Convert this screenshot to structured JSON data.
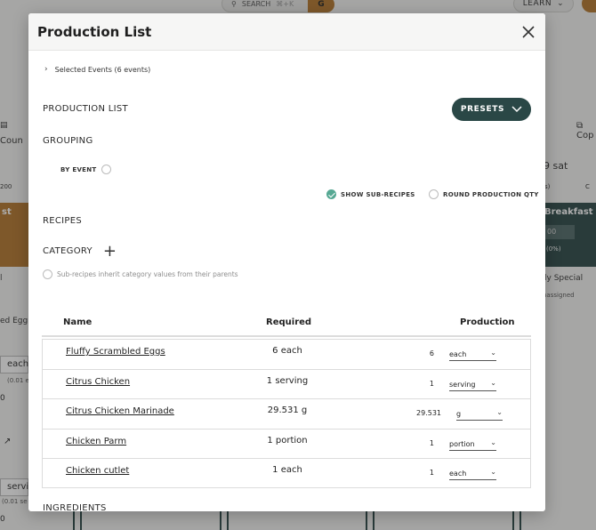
{
  "background": {
    "search_label": "SEARCH",
    "search_shortcut": "⌘+K",
    "avatar_letter": "G",
    "learn_label": "LEARN",
    "left_icon_label": "Coun",
    "left_count": "200",
    "left_event_label": "st",
    "left_text1": "l",
    "left_text2": "ed Egg",
    "left_unit1": "each",
    "left_small1": "(0.01 e",
    "left_zero1": "0",
    "left_unit2": "servi",
    "left_small2": "(0.01 se",
    "left_zero2": "0",
    "right_copy_label": "Cop",
    "right_date": "09 sat",
    "right_s": "s)",
    "right_c": "C",
    "right_event_label": "Breakfast",
    "right_event_value": "00",
    "right_event_pct": "(0%)",
    "right_daily": "aily Special",
    "right_assign": "nassigned"
  },
  "modal": {
    "title": "Production List",
    "selected_events": "Selected Events (6 events)",
    "production_list_label": "PRODUCTION LIST",
    "presets_label": "PRESETS",
    "grouping_label": "GROUPING",
    "by_event_label": "BY EVENT",
    "show_subrecipes_label": "SHOW SUB-RECIPES",
    "round_qty_label": "ROUND PRODUCTION QTY",
    "recipes_label": "RECIPES",
    "category_label": "CATEGORY",
    "inherit_note": "Sub-recipes inherit category values from their parents",
    "table_headers": {
      "name": "Name",
      "required": "Required",
      "production": "Production"
    },
    "rows": [
      {
        "name": "Fluffy Scrambled Eggs",
        "required": "6 each",
        "qty": "6",
        "unit": "each"
      },
      {
        "name": "Citrus Chicken",
        "required": "1 serving",
        "qty": "1",
        "unit": "serving"
      },
      {
        "name": "Citrus Chicken Marinade",
        "required": "29.531 g",
        "qty": "29.531",
        "unit": "g"
      },
      {
        "name": "Chicken Parm",
        "required": "1 portion",
        "qty": "1",
        "unit": "portion"
      },
      {
        "name": "Chicken cutlet",
        "required": "1 each",
        "qty": "1",
        "unit": "each"
      }
    ],
    "ingredients_label": "INGREDIENTS"
  },
  "colors": {
    "accent": "#2a4746",
    "orange": "#b3772c",
    "check": "#56a893"
  }
}
